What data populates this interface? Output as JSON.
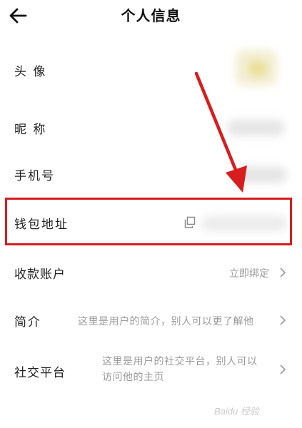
{
  "header": {
    "title": "个人信息"
  },
  "rows": {
    "avatar": {
      "label": "头 像"
    },
    "nickname": {
      "label": "昵 称"
    },
    "phone": {
      "label": "手机号"
    },
    "wallet": {
      "label": "钱包地址"
    },
    "payment": {
      "label": "收款账户",
      "value": "立即绑定"
    },
    "intro": {
      "label": "简介",
      "value": "这里是用户的简介，别人可以更了解他"
    },
    "social": {
      "label": "社交平台",
      "value_line1": "这里是用户的社交平台，别人可以",
      "value_line2": "访问他的主页"
    }
  },
  "watermark": "Baidu 经验",
  "colors": {
    "highlight": "#d71d1d",
    "secondary_text": "#9a9a9a"
  }
}
